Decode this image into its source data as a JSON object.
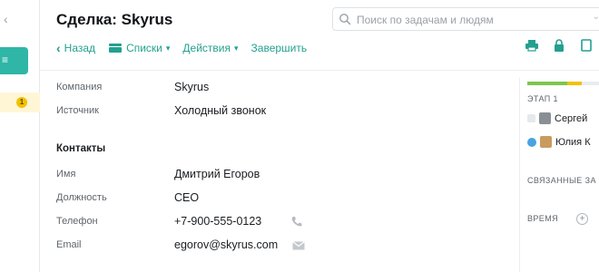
{
  "header": {
    "title": "Сделка: Skyrus",
    "search": {
      "placeholder": "Поиск по задачам и людям"
    }
  },
  "toolbar": {
    "back_label": "Назад",
    "lists_label": "Списки",
    "actions_label": "Действия",
    "finish_label": "Завершить"
  },
  "left_rail": {
    "badge_count": "1"
  },
  "fields": {
    "company": {
      "label": "Компания",
      "value": "Skyrus"
    },
    "source": {
      "label": "Источник",
      "value": "Холодный звонок"
    },
    "contacts_title": "Контакты",
    "name": {
      "label": "Имя",
      "value": "Дмитрий Егоров"
    },
    "position": {
      "label": "Должность",
      "value": "CEO"
    },
    "phone": {
      "label": "Телефон",
      "value": "+7-900-555-0123"
    },
    "email": {
      "label": "Email",
      "value": "egorov@skyrus.com"
    }
  },
  "side_panel": {
    "stage_label": "ЭТАП 1",
    "assignees": [
      "Сергей",
      "Юлия К"
    ],
    "related_title": "СВЯЗАННЫЕ ЗА",
    "time_title": "ВРЕМЯ",
    "progress": 0.55
  },
  "colors": {
    "accent": "#23a08f",
    "rail_active": "#2fb6a7",
    "progress_green": "#7bc74d",
    "progress_yellow": "#f2c200"
  }
}
